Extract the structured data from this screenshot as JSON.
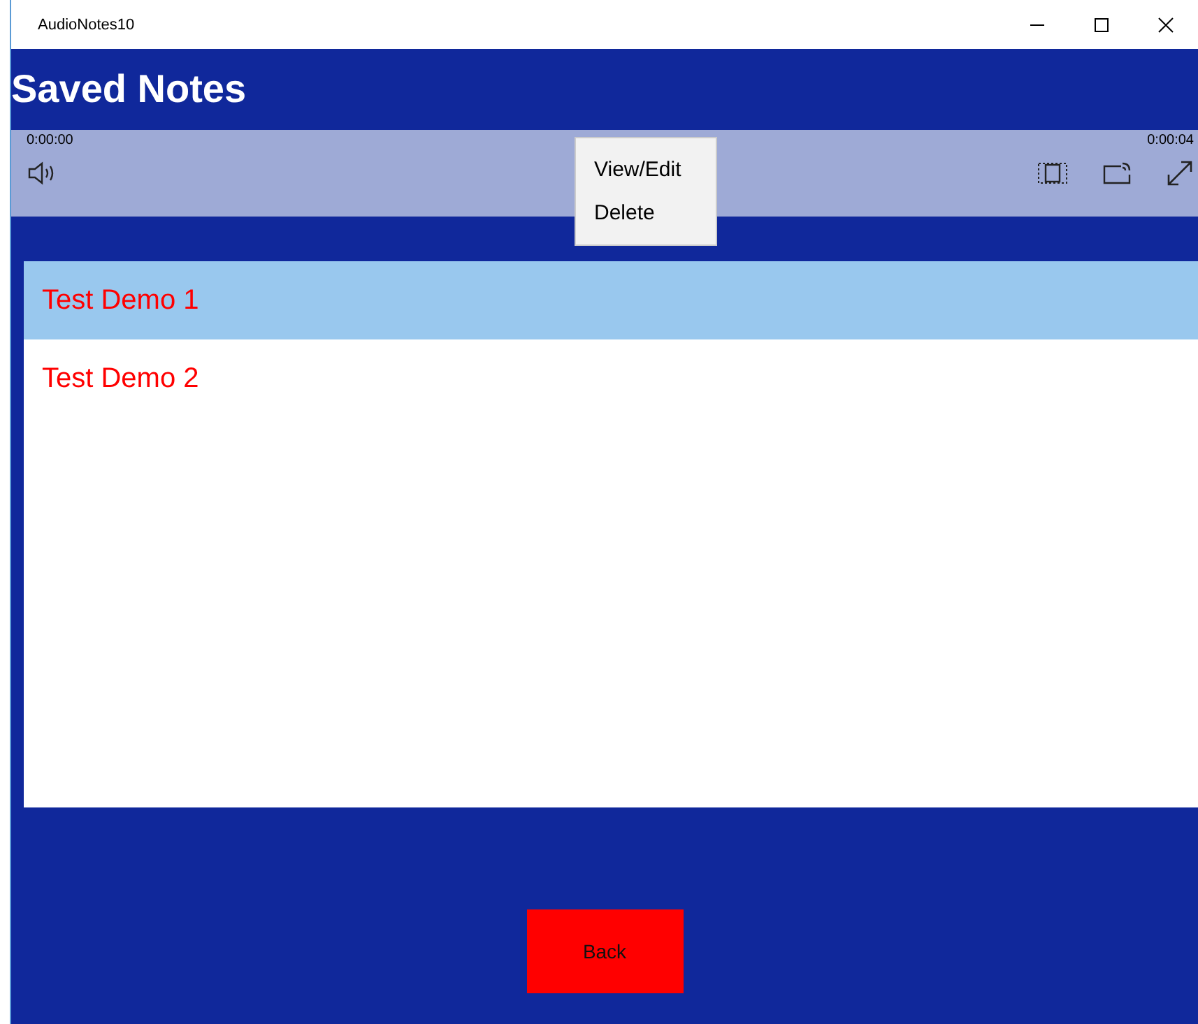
{
  "window": {
    "title": "AudioNotes10"
  },
  "header": {
    "title": "Saved Notes"
  },
  "player": {
    "elapsed": "0:00:00",
    "total": "0:00:04"
  },
  "context_menu": {
    "items": [
      "View/Edit",
      "Delete"
    ]
  },
  "notes": [
    {
      "label": "Test Demo 1",
      "selected": true
    },
    {
      "label": "Test Demo 2",
      "selected": false
    }
  ],
  "back_button": "Back"
}
